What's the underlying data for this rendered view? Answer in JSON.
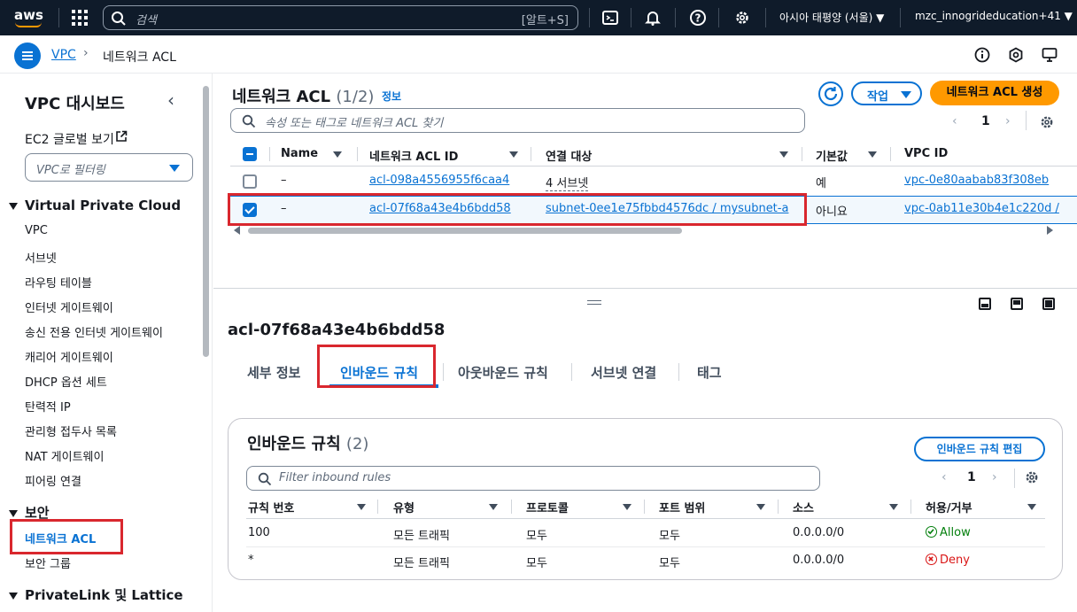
{
  "topbar": {
    "logo": "aws",
    "search_placeholder": "검색",
    "search_shortcut": "[알트+S]",
    "region": "아시아 태평양 (서울) ▼",
    "account": "mzc_innogrideducation+41 ▼",
    "icons": [
      "grid-icon",
      "cloudshell-icon",
      "bell-icon",
      "help-icon",
      "gear-icon"
    ]
  },
  "breadcrumb": {
    "root": "VPC",
    "current": "네트워크 ACL"
  },
  "sidebar": {
    "title": "VPC 대시보드",
    "global_view": "EC2 글로벌 보기",
    "filter_placeholder": "VPC로 필터링",
    "sections": [
      {
        "label": "Virtual Private Cloud",
        "items": [
          "VPC",
          "서브넷",
          "라우팅 테이블",
          "인터넷 게이트웨이",
          "송신 전용 인터넷 게이트웨이",
          "캐리어 게이트웨이",
          "DHCP 옵션 세트",
          "탄력적 IP",
          "관리형 접두사 목록",
          "NAT 게이트웨이",
          "피어링 연결"
        ]
      },
      {
        "label": "보안",
        "items": [
          "네트워크 ACL",
          "보안 그룹"
        ]
      },
      {
        "label": "PrivateLink 및 Lattice",
        "items": []
      }
    ]
  },
  "list": {
    "title": "네트워크 ACL",
    "count": "(1/2)",
    "info": "정보",
    "actions_label": "작업",
    "create_label": "네트워크 ACL 생성",
    "search_placeholder": "속성 또는 태그로 네트워크 ACL 찾기",
    "page": "1",
    "columns": [
      "Name",
      "네트워크 ACL ID",
      "연결 대상",
      "기본값",
      "VPC ID"
    ],
    "rows": [
      {
        "name": "–",
        "acl_id": "acl-098a4556955f6caa4",
        "assoc": "4 서브넷",
        "default": "예",
        "vpc": "vpc-0e80aabab83f308eb",
        "selected": false
      },
      {
        "name": "–",
        "acl_id": "acl-07f68a43e4b6bdd58",
        "assoc": "subnet-0ee1e75fbbd4576dc / mysubnet-a",
        "default": "아니요",
        "vpc": "vpc-0ab11e30b4e1c220d / ",
        "selected": true
      }
    ]
  },
  "detail": {
    "title": "acl-07f68a43e4b6bdd58",
    "tabs": [
      "세부 정보",
      "인바운드 규칙",
      "아웃바운드 규칙",
      "서브넷 연결",
      "태그"
    ],
    "active_tab": 1,
    "card": {
      "title": "인바운드 규칙",
      "count": "(2)",
      "edit_label": "인바운드 규칙 편집",
      "search_placeholder": "Filter inbound rules",
      "page": "1",
      "columns": [
        "규칙 번호",
        "유형",
        "프로토콜",
        "포트 범위",
        "소스",
        "허용/거부"
      ],
      "rules": [
        {
          "num": "100",
          "type": "모든 트래픽",
          "proto": "모두",
          "port": "모두",
          "source": "0.0.0.0/0",
          "action": "Allow"
        },
        {
          "num": "*",
          "type": "모든 트래픽",
          "proto": "모두",
          "port": "모두",
          "source": "0.0.0.0/0",
          "action": "Deny"
        }
      ]
    }
  },
  "colors": {
    "accent": "#0972d3",
    "create": "#ff9900",
    "highlight": "#d9272e",
    "allow": "#037f0c",
    "deny": "#d91515",
    "topbar": "#0f1b2a"
  }
}
